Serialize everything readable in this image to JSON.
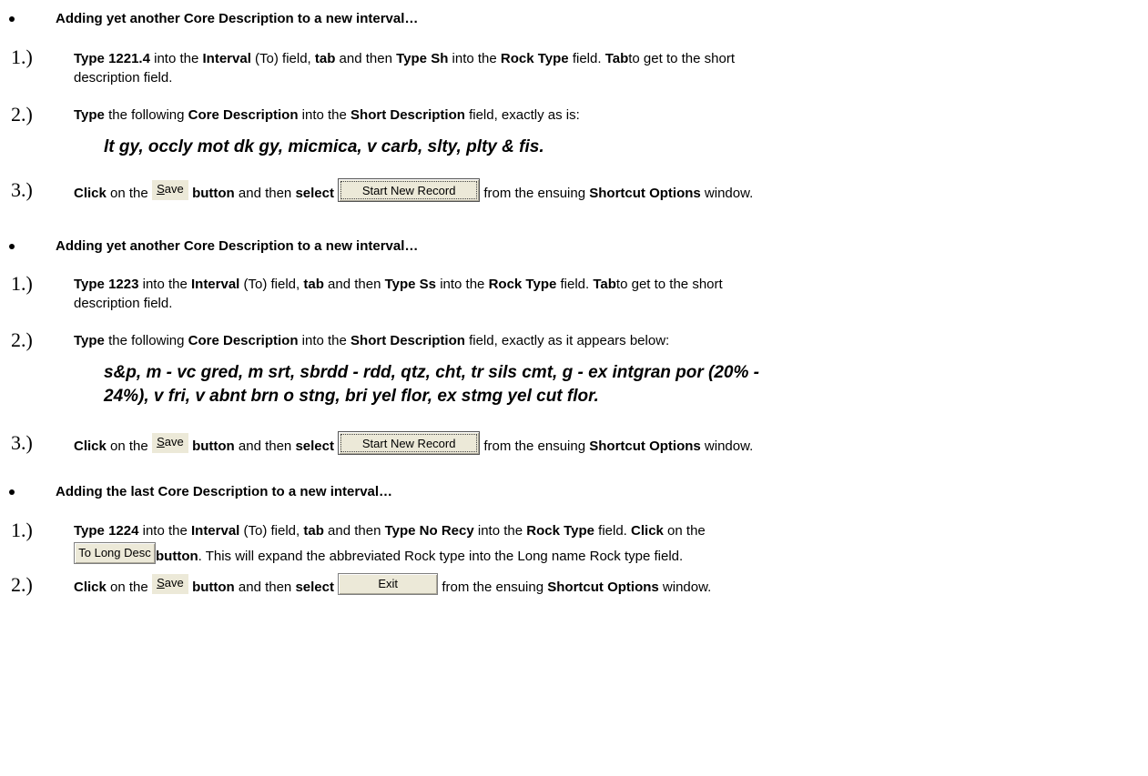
{
  "bullets": [
    "Adding yet another Core Description to a new interval…",
    "Adding yet another Core Description to a new interval…",
    "Adding the last Core Description to a new interval…"
  ],
  "step_numbers": {
    "one": "1.)",
    "two": "2.)",
    "three": "3.)"
  },
  "common": {
    "type": "Type",
    "into_the": " into the ",
    "interval": "Interval",
    "to_field": " (To) field, ",
    "tab": "tab",
    "and_then": " and then ",
    "rock_type": "Rock Type",
    "field_dot": " field. ",
    "tab_cap": "Tab",
    "to_get_short": "to get to the short",
    "desc_field": "description field.",
    "the_following": " the following ",
    "core_description": "Core Description",
    "short_description": "Short Description",
    "field_exactly_is": " field, exactly as is:",
    "field_exactly_below": " field, exactly as it appears below:",
    "click": "Click",
    "on_the": " on the ",
    "button": "button",
    "select": "select",
    "from_ensuing": " from the ensuing ",
    "shortcut_options": "Shortcut Options",
    "window": " window.",
    "field": " field. ",
    "expand_text": ". This will expand the abbreviated Rock type into the Long name Rock type field."
  },
  "section1": {
    "depth": "Type 1221.4",
    "rock": "Type Sh",
    "quote": "lt gy, occly mot dk gy, micmica, v carb, slty, plty & fis."
  },
  "section2": {
    "depth": "Type 1223",
    "rock": "Type Ss",
    "quote_line1": "s&p, m - vc gred, m srt, sbrdd - rdd, qtz, cht, tr sils cmt, g - ex intgran por (20% -",
    "quote_line2": "24%), v fri, v abnt brn o stng, bri yel flor, ex stmg yel cut flor."
  },
  "section3": {
    "depth": "Type 1224",
    "rock": "Type No Recy"
  },
  "buttons": {
    "save_s": "S",
    "save_rest": "ave",
    "start_new_record": "Start New Record",
    "to_long_desc": "To Long Desc",
    "exit": "Exit"
  }
}
